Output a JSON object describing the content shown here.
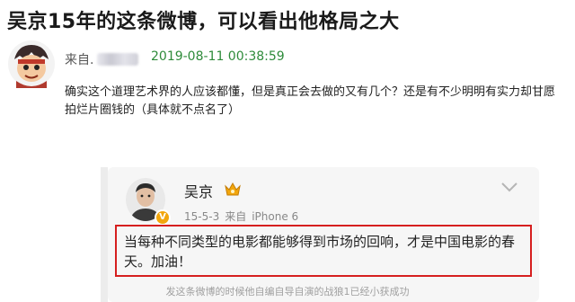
{
  "headline": "吴京15年的这条微博，可以看出他格局之大",
  "post": {
    "from_label": "来自.",
    "date": "2019-08-11 00:38:59",
    "text": "确实这个道理艺术界的人应该都懂，但是真正会去做的又有几个？还是有不少明明有实力却甘愿拍烂片圈钱的（具体就不点名了）"
  },
  "weibo": {
    "name": "吴京",
    "date": "15-5-3",
    "source_prefix": "来自",
    "device": "iPhone 6",
    "quote": "当每种不同类型的电影都能够得到市场的回响，才是中国电影的春天。加油！",
    "verified_badge": "V"
  },
  "caption": "发这条微博的时候他自编自导自演的战狼1已经小获成功",
  "colors": {
    "date_green": "#2e8b3a",
    "highlight_red": "#d61f1f",
    "verified_orange": "#f2a60d"
  },
  "icons": [
    "cartoon-avatar-icon",
    "vip-crown-icon",
    "chevron-down-icon",
    "verified-badge-icon"
  ]
}
